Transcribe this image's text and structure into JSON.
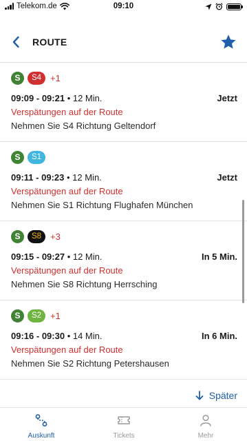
{
  "status_bar": {
    "carrier": "Telekom.de",
    "time": "09:10",
    "icons": [
      "signal-bars",
      "wifi-icon",
      "location-arrow-icon",
      "alarm-icon",
      "battery-icon"
    ]
  },
  "header": {
    "title": "ROUTE",
    "back_icon": "chevron-left-icon",
    "favorite_icon": "star-icon",
    "accent_color": "#1f5ea8"
  },
  "colors": {
    "sbahn_green": "#408335",
    "delay_red": "#d0302f",
    "accent_blue": "#1f5ea8"
  },
  "routes": [
    {
      "mode": "S",
      "line": "S4",
      "line_bg": "#d0302f",
      "line_fg": "#ffffff",
      "extra": "+1",
      "dep": "09:09",
      "sep": " - ",
      "arr": "09:21",
      "duration": "12 Min.",
      "departure": "Jetzt",
      "status": "Verspätungen auf der Route",
      "direction": "Nehmen Sie S4 Richtung Geltendorf"
    },
    {
      "mode": "S",
      "line": "S1",
      "line_bg": "#3fb5e0",
      "line_fg": "#ffffff",
      "extra": "",
      "dep": "09:11",
      "sep": " - ",
      "arr": "09:23",
      "duration": "12 Min.",
      "departure": "Jetzt",
      "status": "Verspätungen auf der Route",
      "direction": "Nehmen Sie S1 Richtung Flughafen München"
    },
    {
      "mode": "S",
      "line": "S8",
      "line_bg": "#111111",
      "line_fg": "#f5b400",
      "extra": "+3",
      "dep": "09:15",
      "sep": " - ",
      "arr": "09:27",
      "duration": "12 Min.",
      "departure": "In 5 Min.",
      "status": "Verspätungen auf der Route",
      "direction": "Nehmen Sie S8 Richtung Herrsching"
    },
    {
      "mode": "S",
      "line": "S2",
      "line_bg": "#6fb43f",
      "line_fg": "#ffffff",
      "extra": "+1",
      "dep": "09:16",
      "sep": " - ",
      "arr": "09:30",
      "duration": "14 Min.",
      "departure": "In 6 Min.",
      "status": "Verspätungen auf der Route",
      "direction": "Nehmen Sie S2 Richtung Petershausen"
    }
  ],
  "later_button": {
    "label": "Später",
    "icon": "arrow-down-icon"
  },
  "tab_bar": [
    {
      "label": "Auskunft",
      "icon": "route-icon",
      "active": true
    },
    {
      "label": "Tickets",
      "icon": "ticket-icon",
      "active": false
    },
    {
      "label": "Mehr",
      "icon": "user-icon",
      "active": false
    }
  ]
}
